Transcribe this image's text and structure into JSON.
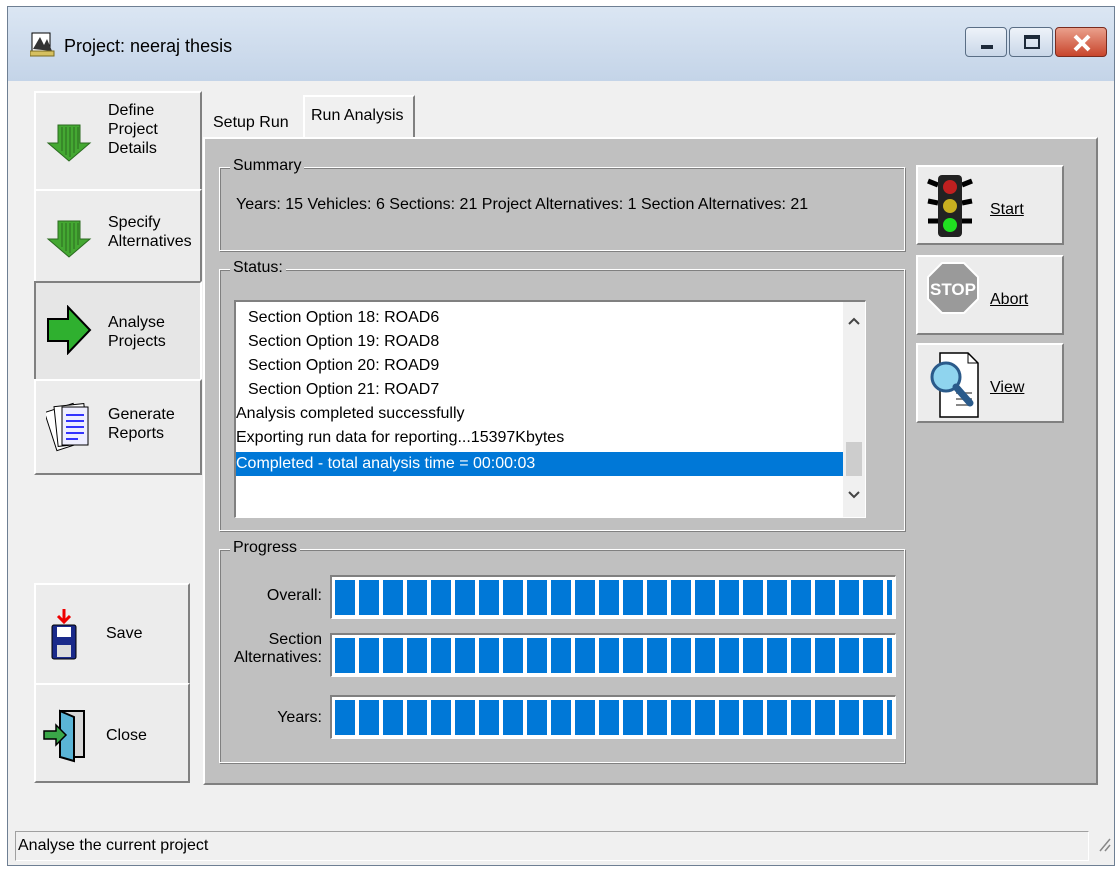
{
  "window": {
    "title": "Project: neeraj thesis"
  },
  "nav": [
    {
      "label": "Define\nProject\nDetails",
      "icon": "down-arrow-icon"
    },
    {
      "label": "Specify\nAlternatives",
      "icon": "down-arrow-icon"
    },
    {
      "label": "Analyse\nProjects",
      "icon": "right-arrow-icon"
    },
    {
      "label": "Generate\nReports",
      "icon": "reports-icon"
    }
  ],
  "side": {
    "save_label": "Save",
    "close_label": "Close"
  },
  "tabs": [
    {
      "label": "Setup Run"
    },
    {
      "label": "Run Analysis",
      "active": true
    }
  ],
  "summary": {
    "legend": "Summary",
    "text": "Years: 15   Vehicles: 6   Sections: 21   Project Alternatives: 1   Section Alternatives: 21"
  },
  "status": {
    "legend": "Status:",
    "lines": [
      "Section Option 18: ROAD6",
      "Section Option 19: ROAD8",
      "Section Option 20: ROAD9",
      "Section Option 21: ROAD7",
      "Analysis completed successfully",
      "Exporting run data for reporting...15397Kbytes",
      "Completed - total analysis time = 00:00:03"
    ],
    "selected_index": 6
  },
  "progress": {
    "legend": "Progress",
    "overall_label": "Overall:",
    "section_label": "Section\nAlternatives:",
    "years_label": "Years:",
    "overall_fraction": 1.0,
    "section_fraction": 1.0,
    "years_fraction": 1.0
  },
  "actions": {
    "start_label": "Start",
    "abort_label": "Abort",
    "view_label": "View"
  },
  "statusbar": {
    "text": "Analyse the current project"
  },
  "colors": {
    "accent": "#0078d7",
    "panel": "#c0c0c0"
  }
}
